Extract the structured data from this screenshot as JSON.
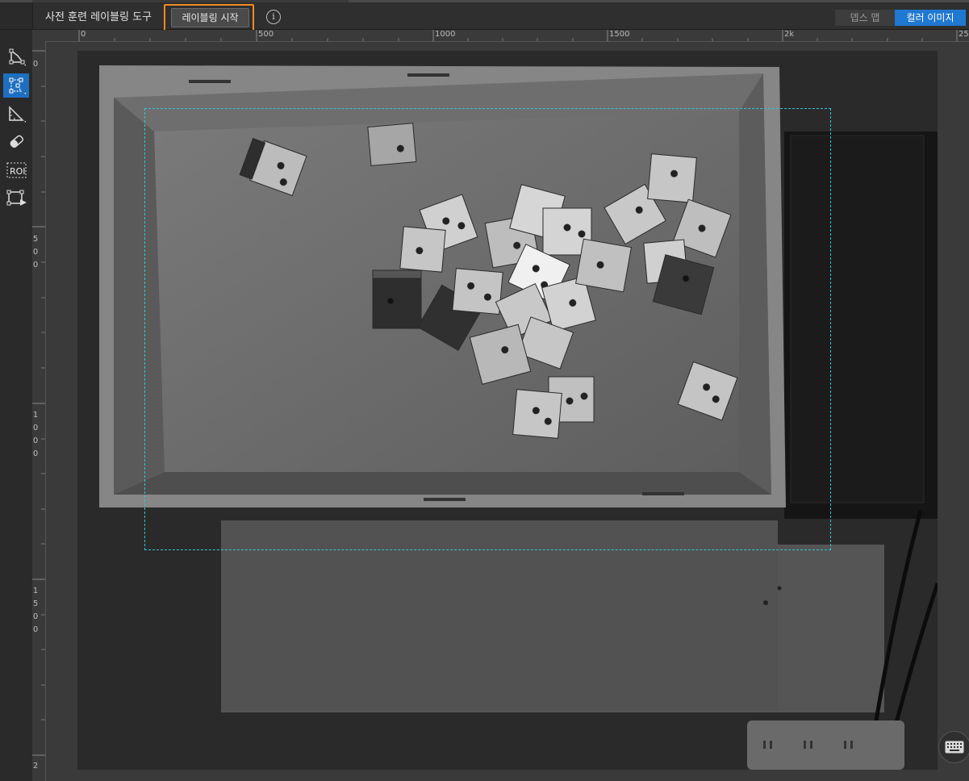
{
  "toolbar": {
    "tool_title": "사전 훈련 레이블링 도구",
    "start_button": "레이블링 시작",
    "info_glyph": "i",
    "view_depth": "뎁스 맵",
    "view_color": "컬러 이미지"
  },
  "ruler": {
    "h_labels": [
      "0",
      "500",
      "1000",
      "1500",
      "2k",
      "25"
    ],
    "v_labels": [
      [
        "0"
      ],
      [
        "5",
        "0",
        "0"
      ],
      [
        "1",
        "0",
        "0",
        "0"
      ],
      [
        "1",
        "5",
        "0",
        "0"
      ],
      [
        "2"
      ]
    ]
  },
  "left_tools": [
    {
      "icon": "polygon-tool-icon",
      "active": false
    },
    {
      "icon": "keypoint-polygon-tool-icon",
      "active": true
    },
    {
      "icon": "ruler-corner-tool-icon",
      "active": false
    },
    {
      "icon": "eraser-tool-icon",
      "active": false
    },
    {
      "icon": "roi-tool-icon",
      "label": "ROI",
      "active": false
    },
    {
      "icon": "frame-play-tool-icon",
      "active": false
    }
  ],
  "right_tools": [
    {
      "icon": "show-polygon-icon"
    },
    {
      "icon": "checklist-visibility-icon"
    },
    {
      "icon": "mask-visibility-icon"
    }
  ],
  "colors": {
    "accent": "#1f78d1",
    "highlight": "#f28a21",
    "roi": "#31c7d1"
  }
}
